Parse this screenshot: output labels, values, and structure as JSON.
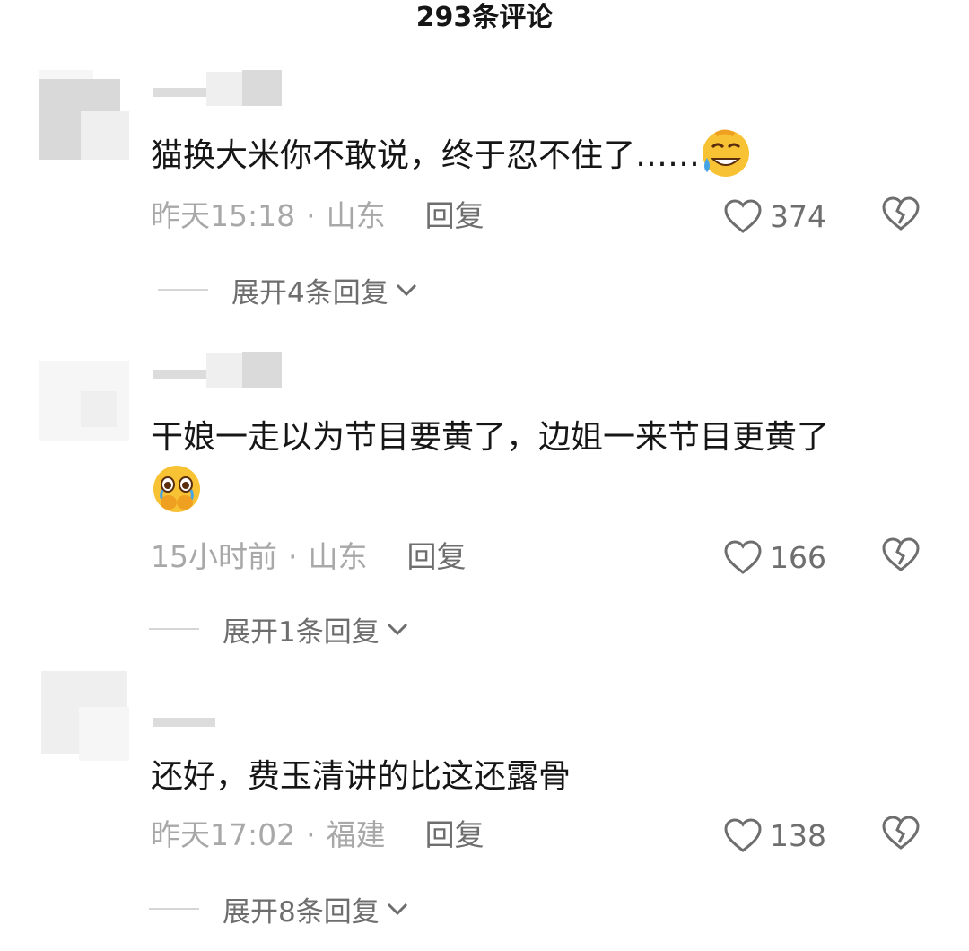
{
  "header": {
    "title": "293条评论"
  },
  "comments": [
    {
      "text": "猫换大米你不敢说，终于忍不住了……",
      "emoji": "rolling-laughing-emoji",
      "time": "昨天15:18",
      "location": "山东",
      "reply_label": "回复",
      "likes": "374",
      "expand_label": "展开4条回复"
    },
    {
      "text": "干娘一走以为节目要黄了，边姐一来节目更黄了",
      "emoji": "holding-back-tears-emoji",
      "time": "15小时前",
      "location": "山东",
      "reply_label": "回复",
      "likes": "166",
      "expand_label": "展开1条回复"
    },
    {
      "text": "还好，费玉清讲的比这还露骨",
      "time": "昨天17:02",
      "location": "福建",
      "reply_label": "回复",
      "likes": "138",
      "expand_label": "展开8条回复"
    }
  ],
  "meta_separator": "·",
  "icons": {
    "like": "heart-outline-icon",
    "dislike": "broken-heart-icon",
    "expand": "chevron-down-icon"
  },
  "colors": {
    "text": "#161616",
    "meta": "#a8a8a8",
    "action": "#6e6e6e"
  }
}
